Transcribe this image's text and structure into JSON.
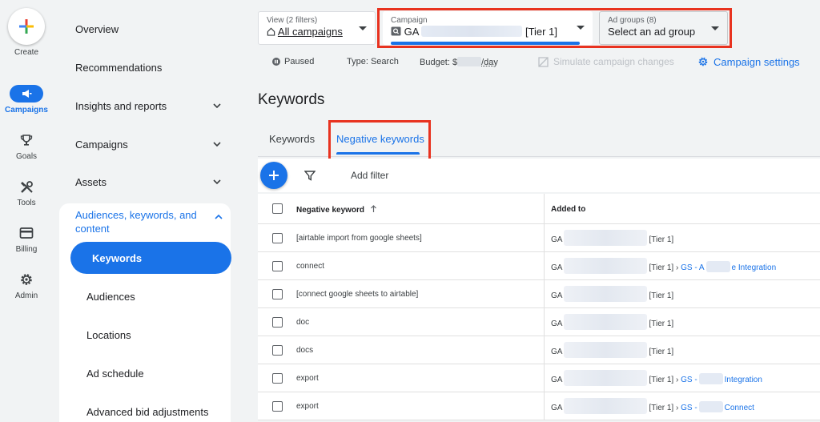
{
  "rail": {
    "create": "Create",
    "campaigns": "Campaigns",
    "goals": "Goals",
    "tools": "Tools",
    "billing": "Billing",
    "admin": "Admin"
  },
  "nav": {
    "overview": "Overview",
    "recommendations": "Recommendations",
    "insights": "Insights and reports",
    "campaigns": "Campaigns",
    "assets": "Assets",
    "audiences_line1": "Audiences, keywords, and",
    "audiences_line2": "content",
    "sub": {
      "keywords": "Keywords",
      "audiences": "Audiences",
      "locations": "Locations",
      "ad_schedule": "Ad schedule",
      "advanced_bid": "Advanced bid adjustments"
    }
  },
  "header": {
    "view_label": "View (2 filters)",
    "view_value": "All campaigns",
    "campaign_label": "Campaign",
    "campaign_prefix": "GA",
    "campaign_suffix": "[Tier 1]",
    "adgroups_label": "Ad groups (8)",
    "adgroups_value": "Select an ad group",
    "status": "Paused",
    "type": "Type: Search",
    "budget_prefix": "Budget: $",
    "budget_suffix": "/day",
    "simulate": "Simulate campaign changes",
    "settings": "Campaign settings"
  },
  "page_title": "Keywords",
  "tabs": {
    "keywords": "Keywords",
    "negative": "Negative keywords"
  },
  "toolbar": {
    "add_filter": "Add filter"
  },
  "table": {
    "col1": "Negative keyword",
    "col2": "Added to",
    "rows": [
      {
        "keyword": "[airtable import from google sheets]",
        "prefix": "GA",
        "tier": "[Tier 1]",
        "sep": "",
        "link1": "",
        "link2": ""
      },
      {
        "keyword": "connect",
        "prefix": "GA",
        "tier": "[Tier 1]",
        "sep": " › ",
        "link1": "GS - A",
        "link2": "e Integration"
      },
      {
        "keyword": "[connect google sheets to airtable]",
        "prefix": "GA",
        "tier": "[Tier 1]",
        "sep": "",
        "link1": "",
        "link2": ""
      },
      {
        "keyword": "doc",
        "prefix": "GA",
        "tier": "[Tier 1]",
        "sep": "",
        "link1": "",
        "link2": ""
      },
      {
        "keyword": "docs",
        "prefix": "GA",
        "tier": "[Tier 1]",
        "sep": "",
        "link1": "",
        "link2": ""
      },
      {
        "keyword": "export",
        "prefix": "GA",
        "tier": "[Tier 1]",
        "sep": " › ",
        "link1": "GS -",
        "link2": "Integration"
      },
      {
        "keyword": "export",
        "prefix": "GA",
        "tier": "[Tier 1]",
        "sep": " › ",
        "link1": "GS -",
        "link2": "Connect"
      }
    ]
  },
  "colors": {
    "accent": "#1a73e8",
    "highlight": "#e8321f"
  }
}
